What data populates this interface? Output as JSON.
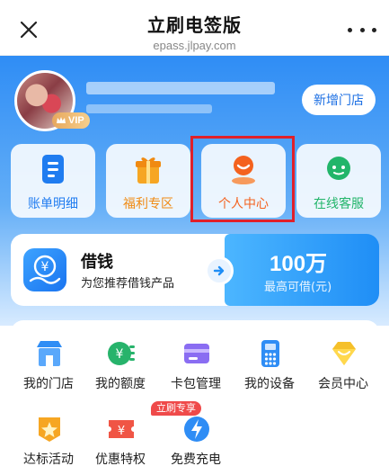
{
  "header": {
    "title": "立刷电签版",
    "subtitle": "epass.jlpay.com",
    "close_icon": "close-icon",
    "more_icon": "more-icon"
  },
  "profile": {
    "vip_label": "VIP",
    "new_store_button": "新增门店"
  },
  "quick_tiles": [
    {
      "label": "账单明细",
      "icon": "bill-icon",
      "color": "#1f7cf0"
    },
    {
      "label": "福利专区",
      "icon": "gift-icon",
      "color": "#f08a12"
    },
    {
      "label": "个人中心",
      "icon": "person-icon",
      "color": "#f4621e"
    },
    {
      "label": "在线客服",
      "icon": "customer-service-icon",
      "color": "#22b56a"
    }
  ],
  "loan": {
    "title": "借钱",
    "subtitle": "为您推荐借钱产品",
    "amount": "100万",
    "amount_label": "最高可借(元)"
  },
  "services": [
    {
      "label": "我的门店",
      "icon": "store-icon"
    },
    {
      "label": "我的额度",
      "icon": "credit-limit-icon"
    },
    {
      "label": "卡包管理",
      "icon": "card-wallet-icon"
    },
    {
      "label": "我的设备",
      "icon": "device-icon"
    },
    {
      "label": "会员中心",
      "icon": "member-icon"
    },
    {
      "label": "达标活动",
      "icon": "activity-icon"
    },
    {
      "label": "优惠特权",
      "icon": "discount-icon"
    },
    {
      "label": "免费充电",
      "icon": "charge-icon"
    }
  ],
  "promo_badge": "立刷专享",
  "colors": {
    "primary_blue": "#2f8df5",
    "highlight_red": "#e0202a"
  }
}
